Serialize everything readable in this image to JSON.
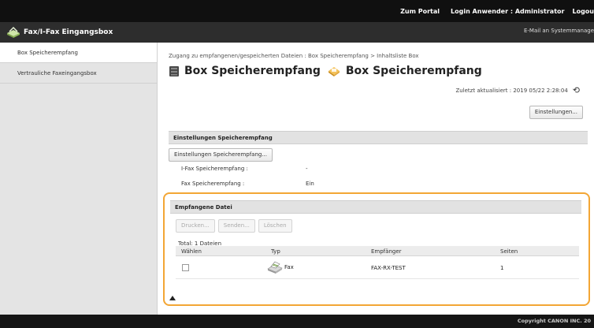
{
  "topbar": {
    "portal_link": "Zum Portal",
    "login_label": "Login Anwender :",
    "login_user": "Administrator",
    "logout": "Logou"
  },
  "titlebar": {
    "app_title": "Fax/I-Fax Eingangsbox",
    "app_icon": "fax-icon",
    "email_link": "E-Mail an Systemmanage"
  },
  "sidebar": {
    "items": [
      {
        "label": "Box Speicherempfang",
        "active": true
      },
      {
        "label": "Vertrauliche Faxeingangsbox",
        "active": false
      }
    ]
  },
  "main": {
    "breadcrumb": "Zugang zu empfangenen/gespeicherten Dateien : Box Speicherempfang > Inhaltsliste Box",
    "heading_part1": "Box Speicherempfang",
    "heading_part2": "Box Speicherempfang",
    "updated_label": "Zuletzt aktualisiert : 2019 05/22 2:28:04",
    "settings_button": "Einstellungen..."
  },
  "settings_section": {
    "title": "Einstellungen Speicherempfang",
    "button": "Einstellungen Speicherempfang...",
    "rows": [
      {
        "label": "I-Fax Speicherempfang :",
        "value": "-"
      },
      {
        "label": "Fax Speicherempfang :",
        "value": "Ein"
      }
    ]
  },
  "received_section": {
    "title": "Empfangene Datei",
    "buttons": [
      "Drucken...",
      "Senden...",
      "Löschen"
    ],
    "total": "Total: 1 Dateien",
    "columns": [
      "Wählen",
      "Typ",
      "Empfänger",
      "Seiten"
    ],
    "rows": [
      {
        "type": "Fax",
        "recipient": "FAX-RX-TEST",
        "pages": "1"
      }
    ]
  },
  "footer": {
    "copyright": "Copyright CANON INC. 20"
  },
  "colors": {
    "highlight_border": "#f3a635",
    "topbar_bg": "#101010",
    "titlebar_bg": "#2d2d2d"
  }
}
